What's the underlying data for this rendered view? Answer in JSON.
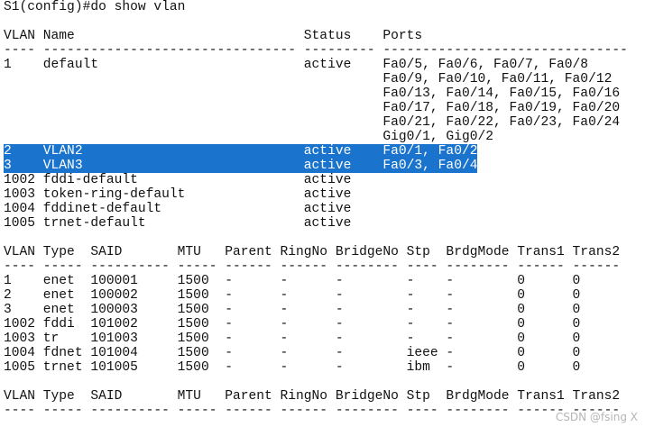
{
  "terminal": {
    "prompt_line": "S1(config)#do show vlan",
    "vlan_table": {
      "header": "VLAN Name                             Status    Ports",
      "divider": "---- -------------------------------- --------- -------------------------------",
      "rows": [
        {
          "vlan": "1",
          "name": "default",
          "status": "active",
          "ports": [
            "Fa0/5, Fa0/6, Fa0/7, Fa0/8",
            "Fa0/9, Fa0/10, Fa0/11, Fa0/12",
            "Fa0/13, Fa0/14, Fa0/15, Fa0/16",
            "Fa0/17, Fa0/18, Fa0/19, Fa0/20",
            "Fa0/21, Fa0/22, Fa0/23, Fa0/24",
            "Gig0/1, Gig0/2"
          ]
        },
        {
          "vlan": "2",
          "name": "VLAN2",
          "status": "active",
          "ports": [
            "Fa0/1, Fa0/2"
          ],
          "selected": true
        },
        {
          "vlan": "3",
          "name": "VLAN3",
          "status": "active",
          "ports": [
            "Fa0/3, Fa0/4"
          ],
          "selected": true
        },
        {
          "vlan": "1002",
          "name": "fddi-default",
          "status": "active",
          "ports": []
        },
        {
          "vlan": "1003",
          "name": "token-ring-default",
          "status": "active",
          "ports": []
        },
        {
          "vlan": "1004",
          "name": "fddinet-default",
          "status": "active",
          "ports": []
        },
        {
          "vlan": "1005",
          "name": "trnet-default",
          "status": "active",
          "ports": []
        }
      ]
    },
    "type_table": {
      "header": "VLAN Type  SAID       MTU   Parent RingNo BridgeNo Stp  BrdgMode Trans1 Trans2",
      "divider": "---- ----- ---------- ----- ------ ------ -------- ---- -------- ------ ------",
      "rows": [
        {
          "vlan": "1",
          "type": "enet",
          "said": "100001",
          "mtu": "1500",
          "parent": "-",
          "ringno": "-",
          "bridgeno": "-",
          "stp": "-",
          "brdgmode": "-",
          "trans1": "0",
          "trans2": "0"
        },
        {
          "vlan": "2",
          "type": "enet",
          "said": "100002",
          "mtu": "1500",
          "parent": "-",
          "ringno": "-",
          "bridgeno": "-",
          "stp": "-",
          "brdgmode": "-",
          "trans1": "0",
          "trans2": "0"
        },
        {
          "vlan": "3",
          "type": "enet",
          "said": "100003",
          "mtu": "1500",
          "parent": "-",
          "ringno": "-",
          "bridgeno": "-",
          "stp": "-",
          "brdgmode": "-",
          "trans1": "0",
          "trans2": "0"
        },
        {
          "vlan": "1002",
          "type": "fddi",
          "said": "101002",
          "mtu": "1500",
          "parent": "-",
          "ringno": "-",
          "bridgeno": "-",
          "stp": "-",
          "brdgmode": "-",
          "trans1": "0",
          "trans2": "0"
        },
        {
          "vlan": "1003",
          "type": "tr",
          "said": "101003",
          "mtu": "1500",
          "parent": "-",
          "ringno": "-",
          "bridgeno": "-",
          "stp": "-",
          "brdgmode": "-",
          "trans1": "0",
          "trans2": "0"
        },
        {
          "vlan": "1004",
          "type": "fdnet",
          "said": "101004",
          "mtu": "1500",
          "parent": "-",
          "ringno": "-",
          "bridgeno": "-",
          "stp": "ieee",
          "brdgmode": "-",
          "trans1": "0",
          "trans2": "0"
        },
        {
          "vlan": "1005",
          "type": "trnet",
          "said": "101005",
          "mtu": "1500",
          "parent": "-",
          "ringno": "-",
          "bridgeno": "-",
          "stp": "ibm",
          "brdgmode": "-",
          "trans1": "0",
          "trans2": "0"
        }
      ]
    },
    "type_table_repeat": {
      "header": "VLAN Type  SAID       MTU   Parent RingNo BridgeNo Stp  BrdgMode Trans1 Trans2",
      "divider": "---- ----- ---------- ----- ------ ------ -------- ---- -------- ------ ------"
    }
  },
  "watermark": "CSDN @fsing X",
  "colors": {
    "background": "#ffffff",
    "text": "#111111",
    "selection": "#1a73cc",
    "selection_text": "#ffffff"
  }
}
